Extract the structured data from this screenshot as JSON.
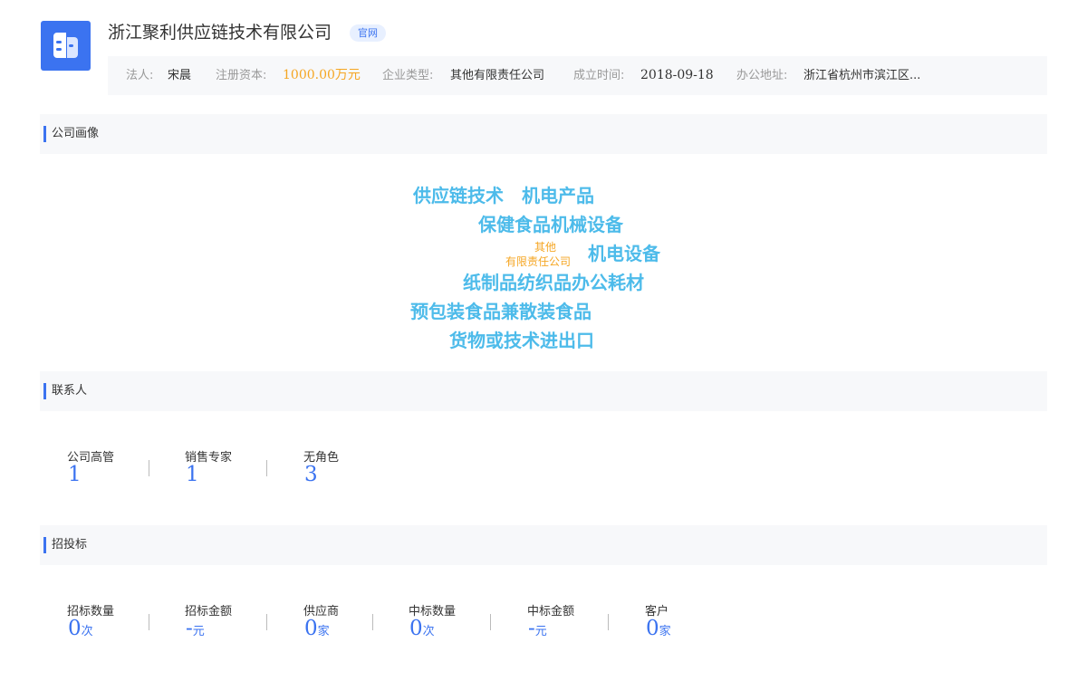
{
  "company": {
    "name": "浙江聚利供应链技术有限公司",
    "website_tag": "官网",
    "logo_icon": "building-icon",
    "brand_color": "#3b73f0"
  },
  "info": {
    "legal_rep_label": "法人:",
    "legal_rep_value": "宋晨",
    "capital_label": "注册资本:",
    "capital_value": "1000.00万元",
    "type_label": "企业类型:",
    "type_value": "其他有限责任公司",
    "founded_label": "成立时间:",
    "founded_value": "2018-09-18",
    "address_label": "办公地址:",
    "address_value": "浙江省杭州市滨江区..."
  },
  "profile": {
    "title": "公司画像",
    "words": [
      "供应链技术",
      "机电产品",
      "保健食品机械设备",
      "其他",
      "有限责任公司",
      "机电设备",
      "纸制品纺织品办公耗材",
      "预包装食品兼散装食品",
      "货物或技术进出口"
    ],
    "word_color": "#4dbbea",
    "highlight_color": "#f5a623"
  },
  "contacts": {
    "title": "联系人",
    "stats": [
      {
        "label": "公司高管",
        "value": "1"
      },
      {
        "label": "销售专家",
        "value": "1"
      },
      {
        "label": "无角色",
        "value": "3"
      }
    ]
  },
  "bidding": {
    "title": "招投标",
    "stats": [
      {
        "label": "招标数量",
        "value": "0",
        "unit": "次"
      },
      {
        "label": "招标金额",
        "value": "-",
        "unit": "元"
      },
      {
        "label": "供应商",
        "value": "0",
        "unit": "家"
      },
      {
        "label": "中标数量",
        "value": "0",
        "unit": "次"
      },
      {
        "label": "中标金额",
        "value": "-",
        "unit": "元"
      },
      {
        "label": "客户",
        "value": "0",
        "unit": "家"
      }
    ]
  }
}
